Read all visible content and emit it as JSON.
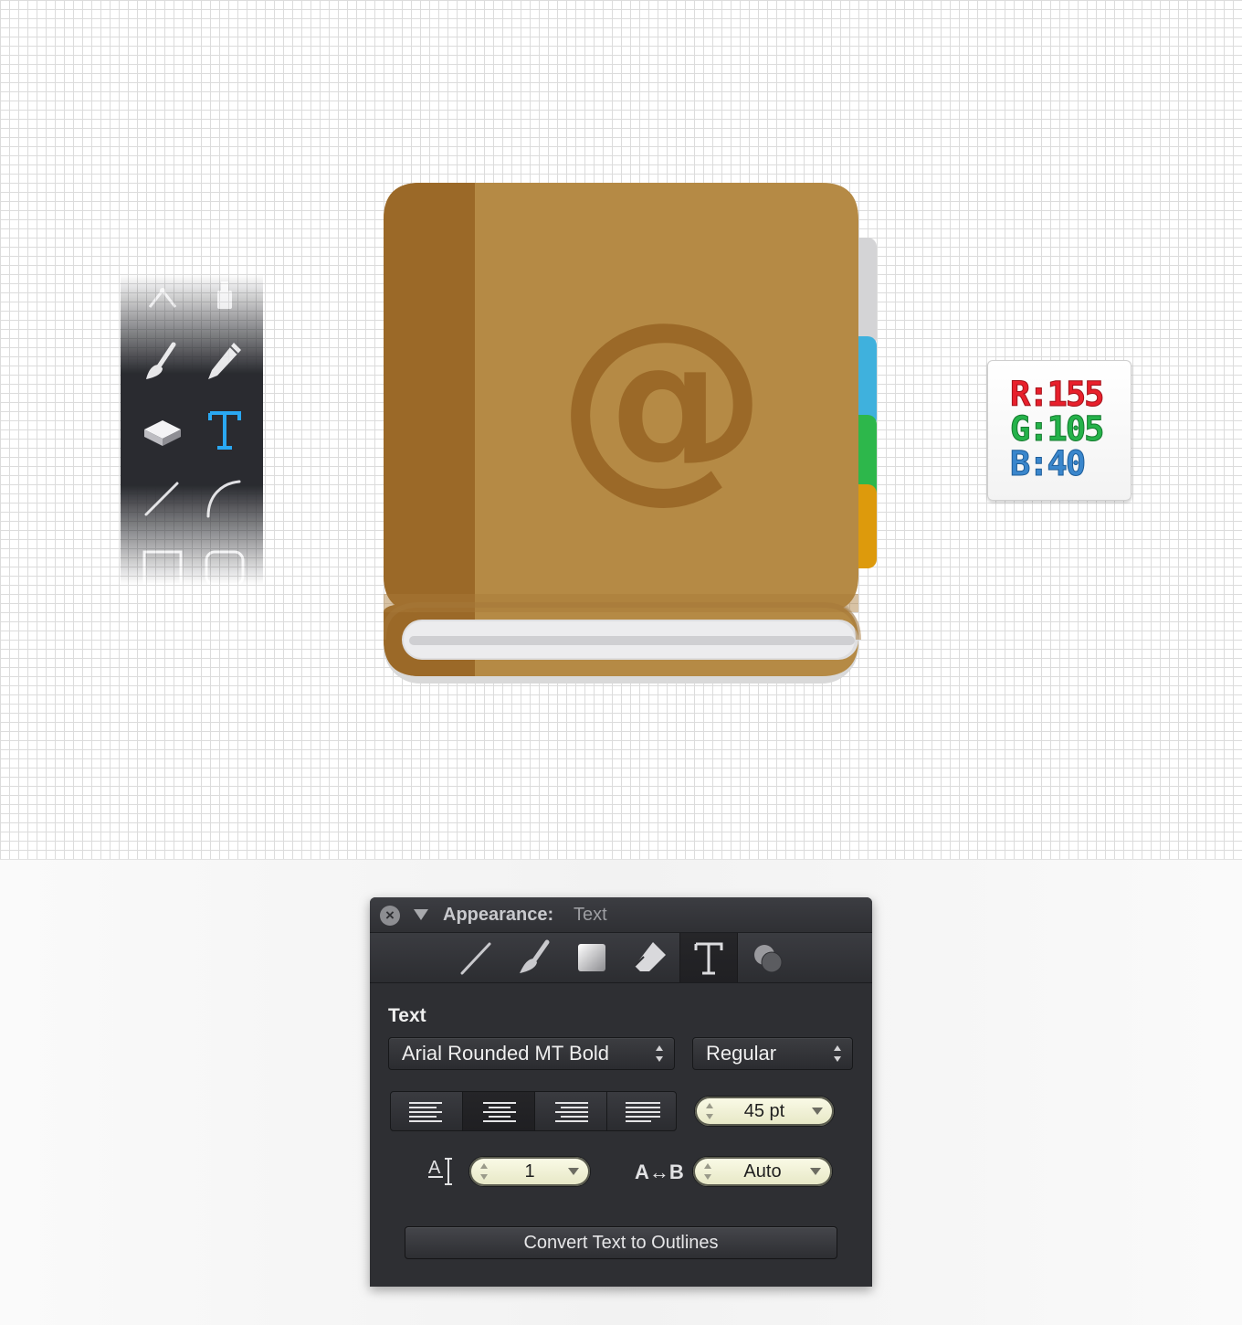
{
  "tools": [
    {
      "name": "pen-icon",
      "active": false
    },
    {
      "name": "text-pen-icon",
      "active": false
    },
    {
      "name": "brush-icon",
      "active": false
    },
    {
      "name": "pencil-icon",
      "active": false
    },
    {
      "name": "eraser-icon",
      "active": false
    },
    {
      "name": "text-tool-icon",
      "active": true
    },
    {
      "name": "line-icon",
      "active": false
    },
    {
      "name": "arc-icon",
      "active": false
    },
    {
      "name": "rectangle-icon",
      "active": false
    },
    {
      "name": "rounded-rectangle-icon",
      "active": false
    }
  ],
  "book": {
    "symbol": "@",
    "cover_color": "#b58a45",
    "spine_color": "#9b6928",
    "symbol_color": "#9b6928",
    "tab_colors": [
      "#d4d4d6",
      "#3fb1dd",
      "#2db74b",
      "#dd9a0c"
    ]
  },
  "swatch": {
    "r": "R:155",
    "g": "G:105",
    "b": "B:40"
  },
  "panel": {
    "title": "Appearance:",
    "subtitle": "Text",
    "tabs": [
      "stroke-icon",
      "brush-icon",
      "fill-icon",
      "eraser-icon",
      "text-icon",
      "effects-icon"
    ],
    "active_tab": "text-icon",
    "section_label": "Text",
    "font_family": "Arial Rounded MT Bold",
    "font_style": "Regular",
    "alignment_options": [
      "left",
      "center",
      "right",
      "justify"
    ],
    "active_alignment": "center",
    "font_size": "45 pt",
    "leading": "1",
    "tracking_icon_label": "A↔B",
    "tracking": "Auto",
    "convert_button": "Convert Text to Outlines"
  }
}
